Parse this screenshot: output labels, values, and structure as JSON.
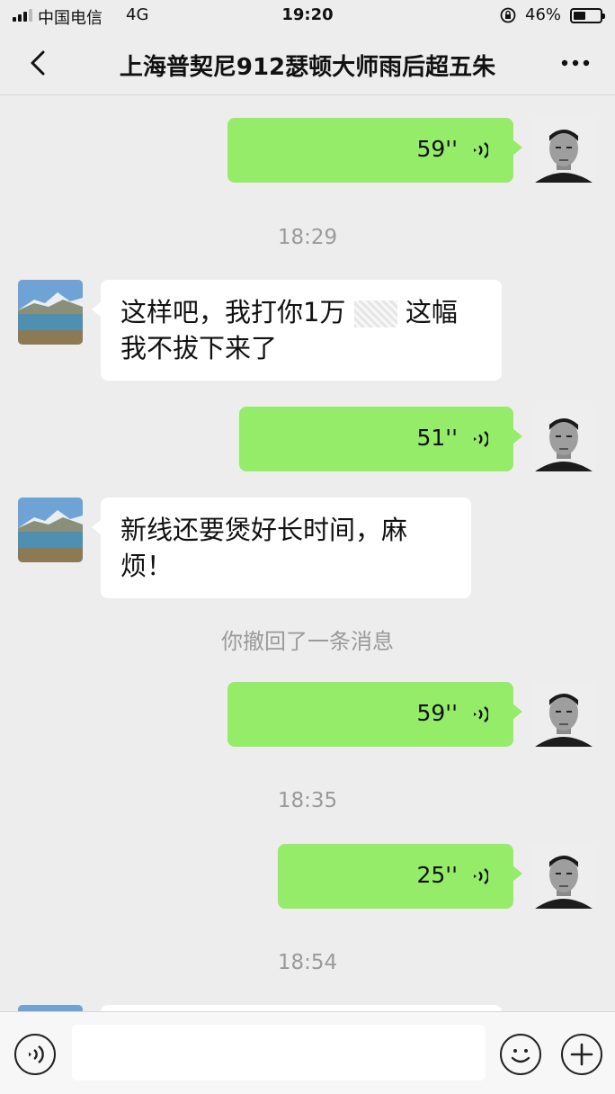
{
  "status_bar": {
    "carrier": "中国电信",
    "network": "4G",
    "time": "19:20",
    "battery_pct": "46%",
    "battery_level": 0.46
  },
  "nav": {
    "title": "上海普契尼912瑟顿大师雨后超五朱",
    "back_icon": "chevron-left-icon",
    "more_icon": "more-dots-icon"
  },
  "messages": {
    "m1": {
      "sender": "self",
      "type": "voice",
      "duration": "59''"
    },
    "t1": "18:29",
    "m2": {
      "sender": "other",
      "type": "text",
      "line1": "这样吧，我打你1万",
      "line1b": "这幅",
      "line2": "我不拔下来了"
    },
    "m3": {
      "sender": "self",
      "type": "voice",
      "duration": "51''"
    },
    "m4": {
      "sender": "other",
      "type": "text",
      "line1": "新线还要煲好长时间，麻",
      "line2": "烦！"
    },
    "recalled": "你撤回了一条消息",
    "m5": {
      "sender": "self",
      "type": "voice",
      "duration": "59''"
    },
    "t2": "18:35",
    "m6": {
      "sender": "self",
      "type": "voice",
      "duration": "25''"
    },
    "t3": "18:54"
  },
  "input_bar": {
    "voice_icon": "voice-input-icon",
    "emoji_icon": "emoji-icon",
    "plus_icon": "plus-icon",
    "text_value": ""
  },
  "colors": {
    "self_bubble": "#95ec69",
    "other_bubble": "#ffffff",
    "background": "#ededed"
  }
}
